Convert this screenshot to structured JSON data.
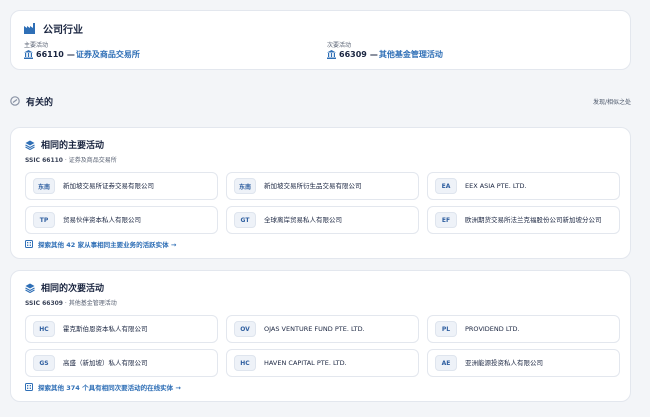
{
  "industry": {
    "title": "公司行业",
    "primary": {
      "label": "主要活动",
      "code": "66110",
      "dash": "—",
      "desc": "证券及商品交易所"
    },
    "secondary": {
      "label": "次要活动",
      "code": "66309",
      "dash": "—",
      "desc": "其他基金管理活动"
    }
  },
  "related": {
    "title": "有关的",
    "link": "发现/相似之处"
  },
  "primary_section": {
    "title": "相同的主要活动",
    "ssic_code": "SSIC 66110",
    "ssic_desc": " · 证券及商品交易所",
    "entities": [
      {
        "badge": "东南",
        "name": "新加坡交易所证券交易有限公司"
      },
      {
        "badge": "东南",
        "name": "新加坡交易所衍生品交易有限公司"
      },
      {
        "badge": "EA",
        "name": "EEX ASIA PTE. LTD."
      },
      {
        "badge": "TP",
        "name": "贸易伙伴资本私人有限公司"
      },
      {
        "badge": "GT",
        "name": "全球离岸贸易私人有限公司"
      },
      {
        "badge": "EF",
        "name": "欧洲期货交易所法兰克福股份公司新加坡分公司"
      }
    ],
    "explore": "探索其他 42 家从事相同主要业务的活跃实体 →"
  },
  "secondary_section": {
    "title": "相同的次要活动",
    "ssic_code": "SSIC 66309",
    "ssic_desc": " · 其他基金管理活动",
    "entities": [
      {
        "badge": "HC",
        "name": "霍克斯伯恩资本私人有限公司"
      },
      {
        "badge": "OV",
        "name": "OJAS VENTURE FUND PTE. LTD."
      },
      {
        "badge": "PL",
        "name": "PROVIDEND LTD."
      },
      {
        "badge": "GS",
        "name": "高盛（新加坡）私人有限公司"
      },
      {
        "badge": "HC",
        "name": "HAVEN CAPITAL PTE. LTD."
      },
      {
        "badge": "AE",
        "name": "亚洲能源投资私人有限公司"
      }
    ],
    "explore": "探索其他 374 个具有相同次要活动的在线实体 →"
  },
  "colors": {
    "accent": "#2f6fb6",
    "title": "#1a2540",
    "muted": "#5b6475"
  },
  "icons": [
    "factory-icon",
    "bank-icon",
    "link-icon",
    "layers-icon",
    "building-icon"
  ]
}
